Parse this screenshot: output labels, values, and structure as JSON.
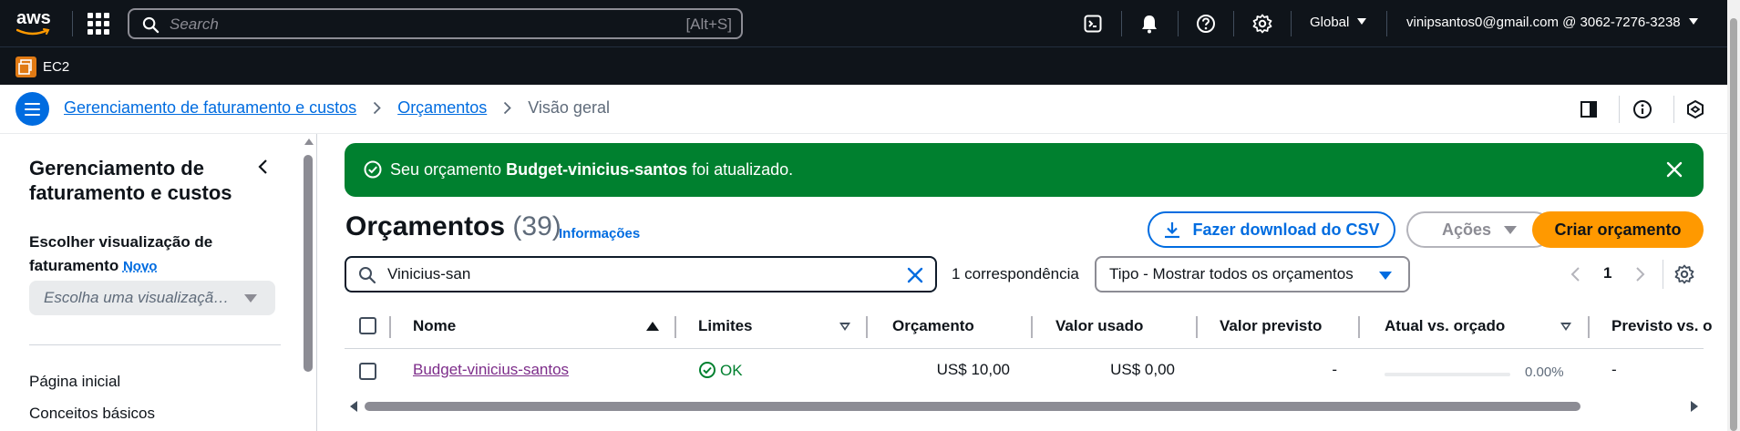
{
  "topnav": {
    "logo": "aws",
    "search_placeholder": "Search",
    "search_shortcut": "[Alt+S]",
    "region": "Global",
    "account": "vinipsantos0@gmail.com @ 3062-7276-3238",
    "icons": [
      "cloudshell-icon",
      "bell-icon",
      "help-icon",
      "gear-icon"
    ]
  },
  "servicebar": {
    "service": "EC2"
  },
  "breadcrumbs": {
    "items": [
      "Gerenciamento de faturamento e custos",
      "Orçamentos"
    ],
    "current": "Visão geral"
  },
  "sidenav": {
    "title": "Gerenciamento de faturamento e custos",
    "view_label": "Escolher visualização de faturamento",
    "new_badge": "Novo",
    "select_placeholder": "Escolha uma visualizaçã…",
    "items": [
      "Página inicial",
      "Conceitos básicos"
    ]
  },
  "flash": {
    "prefix": "Seu orçamento ",
    "budget_name": "Budget-vinicius-santos",
    "suffix": " foi atualizado."
  },
  "header": {
    "title": "Orçamentos",
    "count": "(39)",
    "info": "Informações",
    "download_csv": "Fazer download do CSV",
    "actions": "Ações",
    "create": "Criar orçamento"
  },
  "filter": {
    "value": "Vinicius-san",
    "matches": "1 correspondência",
    "type_select": "Tipo - Mostrar todos os orçamentos"
  },
  "pagination": {
    "current_page": "1"
  },
  "table": {
    "columns": [
      "Nome",
      "Limites",
      "Orçamento",
      "Valor usado",
      "Valor previsto",
      "Atual vs. orçado",
      "Previsto vs. o"
    ],
    "rows": [
      {
        "name": "Budget-vinicius-santos",
        "limits": "OK",
        "budget": "US$ 10,00",
        "used": "US$ 0,00",
        "forecast": "-",
        "actual_vs_budget": "0.00%",
        "actual_vs_budget_fraction": 0,
        "forecast_vs_budget": "-"
      }
    ]
  },
  "colors": {
    "nav_bg": "#0f141a",
    "link": "#006ce0",
    "success": "#00802f",
    "primary_button": "#ff9900",
    "visited_link": "#7d2d8a"
  }
}
